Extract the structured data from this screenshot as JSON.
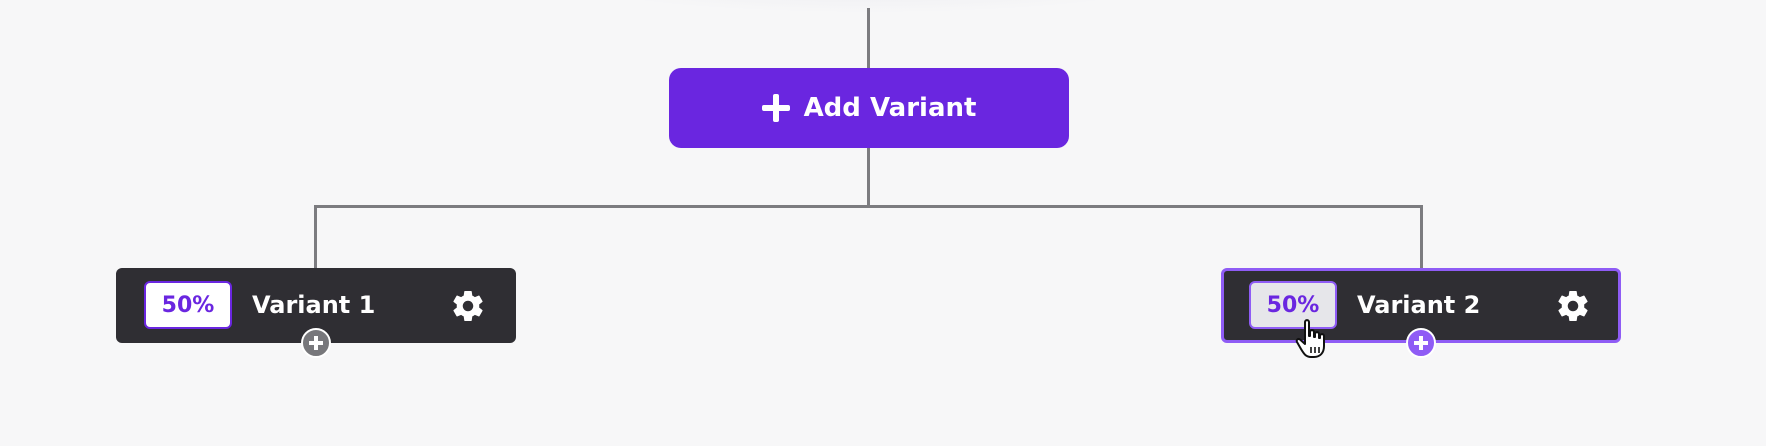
{
  "add_variant": {
    "label": "Add Variant",
    "icon": "plus-icon"
  },
  "variants": [
    {
      "percentage": "50%",
      "name": "Variant 1",
      "settings_icon": "gear-icon",
      "selected": false
    },
    {
      "percentage": "50%",
      "name": "Variant 2",
      "settings_icon": "gear-icon",
      "selected": true
    }
  ],
  "colors": {
    "accent": "#6a26e0",
    "accent_light": "#8f5cf5",
    "card_bg": "#2f2e33",
    "connector": "#7c7c80",
    "background": "#f7f7f8"
  }
}
